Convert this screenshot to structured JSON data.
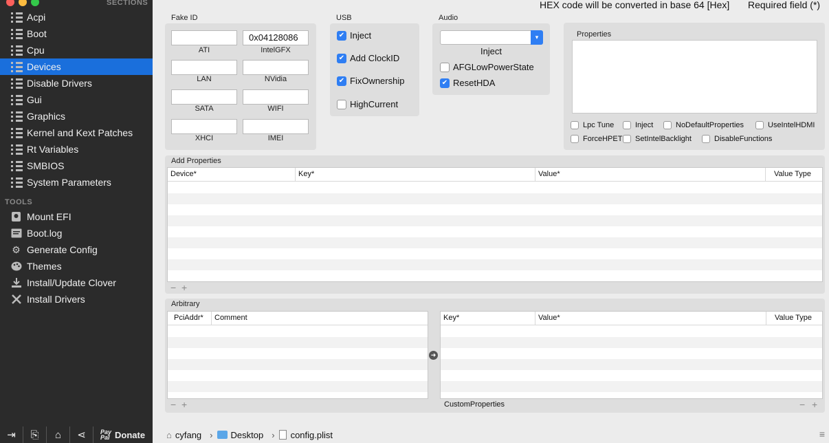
{
  "sidebar": {
    "sections_header": "SECTIONS",
    "items": [
      {
        "label": "Acpi"
      },
      {
        "label": "Boot"
      },
      {
        "label": "Cpu"
      },
      {
        "label": "Devices"
      },
      {
        "label": "Disable Drivers"
      },
      {
        "label": "Gui"
      },
      {
        "label": "Graphics"
      },
      {
        "label": "Kernel and Kext Patches"
      },
      {
        "label": "Rt Variables"
      },
      {
        "label": "SMBIOS"
      },
      {
        "label": "System Parameters"
      }
    ],
    "selected": "Devices",
    "tools_header": "TOOLS",
    "tools": [
      {
        "label": "Mount EFI",
        "icon": "disk-icon"
      },
      {
        "label": "Boot.log",
        "icon": "log-icon"
      },
      {
        "label": "Generate Config",
        "icon": "gears-icon"
      },
      {
        "label": "Themes",
        "icon": "palette-icon"
      },
      {
        "label": "Install/Update Clover",
        "icon": "download-icon"
      },
      {
        "label": "Install Drivers",
        "icon": "tools-icon"
      }
    ],
    "bottom": {
      "donate_label": "Donate",
      "paypal_text": "Pay Pal"
    }
  },
  "header": {
    "hex_note": "HEX code will be converted in base 64 [Hex]",
    "required_note": "Required field (*)"
  },
  "fake_id": {
    "title": "Fake ID",
    "fields": [
      {
        "label": "ATI",
        "value": ""
      },
      {
        "label": "IntelGFX",
        "value": "0x04128086"
      },
      {
        "label": "LAN",
        "value": ""
      },
      {
        "label": "NVidia",
        "value": ""
      },
      {
        "label": "SATA",
        "value": ""
      },
      {
        "label": "WIFI",
        "value": ""
      },
      {
        "label": "XHCI",
        "value": ""
      },
      {
        "label": "IMEI",
        "value": ""
      }
    ]
  },
  "usb": {
    "title": "USB",
    "options": [
      {
        "label": "Inject",
        "checked": true
      },
      {
        "label": "Add ClockID",
        "checked": true
      },
      {
        "label": "FixOwnership",
        "checked": true
      },
      {
        "label": "HighCurrent",
        "checked": false
      }
    ]
  },
  "audio": {
    "title": "Audio",
    "inject_label": "Inject",
    "select_value": "",
    "options": [
      {
        "label": "AFGLowPowerState",
        "checked": false
      },
      {
        "label": "ResetHDA",
        "checked": true
      }
    ]
  },
  "properties": {
    "title": "Properties",
    "text": "",
    "options": [
      {
        "label": "Lpc Tune",
        "checked": false
      },
      {
        "label": "Inject",
        "checked": false
      },
      {
        "label": "NoDefaultProperties",
        "checked": false
      },
      {
        "label": "UseIntelHDMI",
        "checked": false
      },
      {
        "label": "ForceHPET",
        "checked": false
      },
      {
        "label": "SetIntelBacklight",
        "checked": false
      },
      {
        "label": "DisableFunctions",
        "checked": false
      }
    ]
  },
  "add_properties": {
    "title": "Add Properties",
    "columns": [
      "Device*",
      "Key*",
      "Value*",
      "Value Type"
    ],
    "rows": []
  },
  "arbitrary": {
    "title": "Arbitrary",
    "left_columns": [
      "PciAddr*",
      "Comment"
    ],
    "right_columns": [
      "Key*",
      "Value*",
      "Value Type"
    ],
    "custom_label": "CustomProperties"
  },
  "pathbar": {
    "segments": [
      "cyfang",
      "Desktop",
      "config.plist"
    ]
  },
  "colors": {
    "sidebar_bg": "#2b2b2b",
    "selection": "#1a6fdc",
    "checkbox_on": "#2f7ef3"
  }
}
